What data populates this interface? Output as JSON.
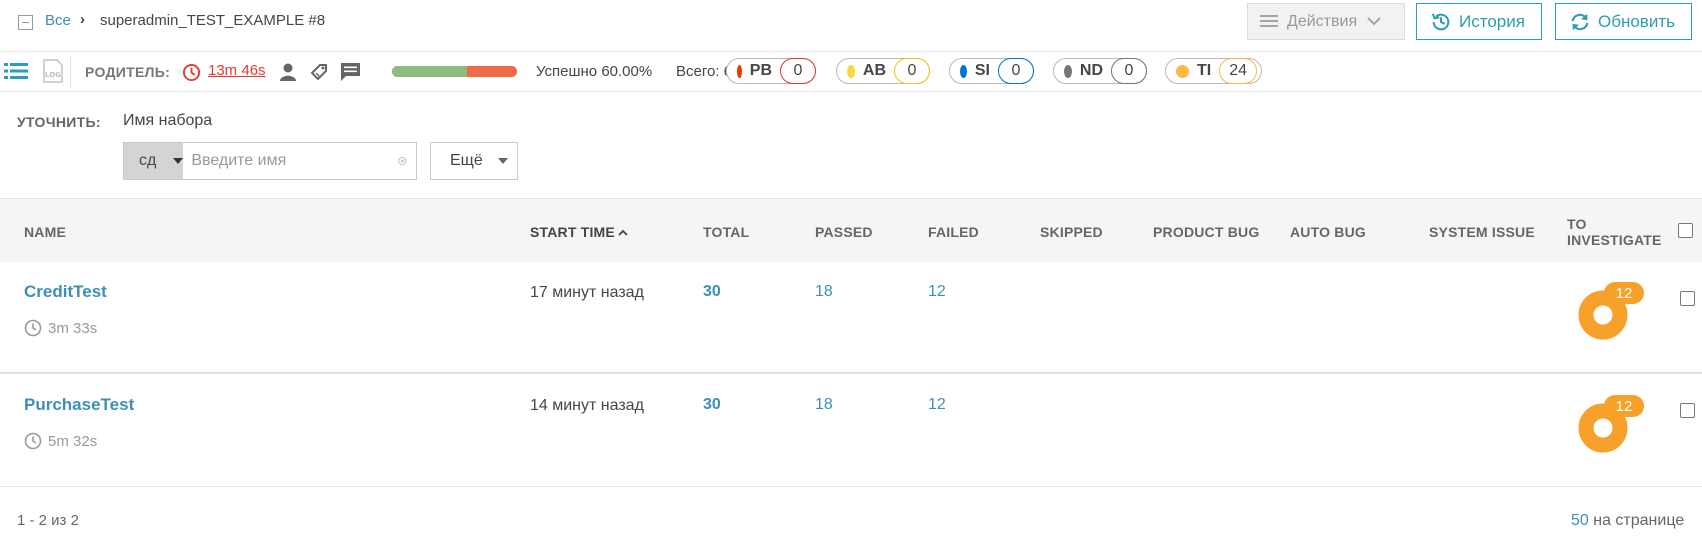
{
  "breadcrumb": {
    "all": "Все",
    "separator": "›",
    "current": "superadmin_TEST_EXAMPLE #8"
  },
  "toolbar": {
    "actions": "Действия",
    "history": "История",
    "refresh": "Обновить"
  },
  "info": {
    "parent_label": "РОДИТЕЛЬ:",
    "duration": "13m 46s",
    "pass_fraction": 0.6,
    "pass_rate": "Успешно 60.00%",
    "total_label": "Всего:",
    "total_value": "60",
    "defects": [
      {
        "code": "PB",
        "count": "0",
        "color": "#ec3900",
        "border": "#e53935"
      },
      {
        "code": "AB",
        "count": "0",
        "color": "#f7d63e",
        "border": "#f2c316"
      },
      {
        "code": "SI",
        "count": "0",
        "color": "#0274d1",
        "border": "#0274d1"
      },
      {
        "code": "ND",
        "count": "0",
        "color": "#777777",
        "border": "#777777"
      },
      {
        "code": "TI",
        "count": "24",
        "color": "#ffb743",
        "border": "#ffb743"
      }
    ]
  },
  "filter": {
    "refine_label": "УТОЧНИТЬ:",
    "name_label": "Имя набора",
    "condition": "сд",
    "placeholder": "Введите имя",
    "more": "Ещё"
  },
  "table": {
    "columns": {
      "name": "NAME",
      "start_time": "START TIME",
      "total": "TOTAL",
      "passed": "PASSED",
      "failed": "FAILED",
      "skipped": "SKIPPED",
      "product_bug": "PRODUCT BUG",
      "auto_bug": "AUTO BUG",
      "system_issue": "SYSTEM ISSUE",
      "to_investigate_1": "TO",
      "to_investigate_2": "INVESTIGATE"
    },
    "rows": [
      {
        "name": "CreditTest",
        "duration": "3m 33s",
        "start": "17 минут назад",
        "total": "30",
        "passed": "18",
        "failed": "12",
        "to_investigate": "12"
      },
      {
        "name": "PurchaseTest",
        "duration": "5m 32s",
        "start": "14 минут назад",
        "total": "30",
        "passed": "18",
        "failed": "12",
        "to_investigate": "12"
      }
    ]
  },
  "pager": {
    "range": "1 - 2 из 2",
    "per_page_count": "50",
    "per_page_text": "на странице"
  },
  "colors": {
    "accent": "#3f8fb5",
    "teal": "#2b9eb0",
    "passed": "#8dbd7c",
    "failed": "#ee6b4a",
    "ti": "#f8a12a"
  }
}
